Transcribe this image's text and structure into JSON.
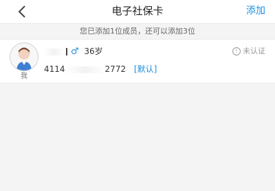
{
  "header": {
    "title": "电子社保卡",
    "add_label": "添加"
  },
  "notice": {
    "text": "您已添加1位成员，还可以添加3位"
  },
  "member": {
    "gender_symbol": "♂",
    "age": "36岁",
    "id_prefix": "4114",
    "id_suffix": "2772",
    "default_tag": "[默认]",
    "relation_label": "我",
    "status_icon": "!",
    "status_text": "未认证"
  },
  "colors": {
    "accent": "#1a8fe0",
    "background": "#f4f4f4"
  },
  "icons": {
    "back": "chevron-left-icon",
    "avatar": "user-avatar-icon",
    "status": "info-icon"
  }
}
